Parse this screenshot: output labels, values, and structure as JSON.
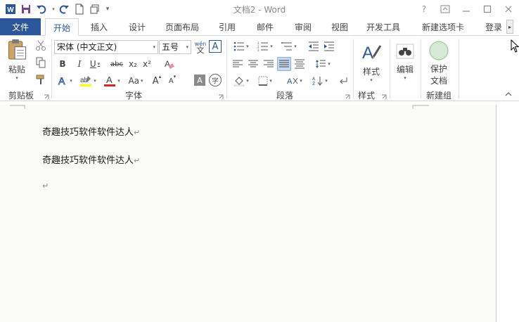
{
  "window": {
    "title": "文档2 - Word",
    "help": "?",
    "minimize": "—",
    "maximize": "□",
    "close": "✕",
    "ribbon_display": "⊡"
  },
  "qat": {
    "save_icon": "save-icon",
    "undo_icon": "undo-icon",
    "redo_icon": "redo-icon",
    "new_icon": "new-document-icon",
    "touch_icon": "touch-mode-icon",
    "customize": "▾"
  },
  "tabs": {
    "file": "文件",
    "home": "开始",
    "insert": "插入",
    "design": "设计",
    "layout": "页面布局",
    "references": "引用",
    "mailings": "邮件",
    "review": "审阅",
    "view": "视图",
    "developer": "开发工具",
    "newtab": "新建选项卡",
    "login": "登录",
    "scroll": "▸"
  },
  "ribbon": {
    "clipboard": {
      "label": "剪贴板",
      "paste": "粘贴"
    },
    "font": {
      "label": "字体",
      "font_name": "宋体 (中文正文)",
      "font_size": "五号",
      "bold": "B",
      "italic": "I",
      "underline": "U",
      "strike": "abc",
      "sub": "x₂",
      "sup": "x²",
      "grow": "A",
      "shrink": "A",
      "case": "Aa",
      "phonetic": "wén",
      "phonetic_sub": "文",
      "border_char": "A",
      "shading_char": "A",
      "enclose_char": "字"
    },
    "paragraph": {
      "label": "段落"
    },
    "styles": {
      "label": "样式",
      "button": "样式"
    },
    "editing": {
      "button": "编辑"
    },
    "newgroup": {
      "label": "新建组",
      "protect_line1": "保护",
      "protect_line2": "文档"
    },
    "colors": {
      "accent": "#2b579a",
      "highlight": "#ffff00",
      "font_color": "#d62728"
    }
  },
  "document": {
    "paragraphs": [
      "奇趣技巧软件软件达人",
      "奇趣技巧软件软件达人",
      ""
    ],
    "para_mark": "↵"
  }
}
